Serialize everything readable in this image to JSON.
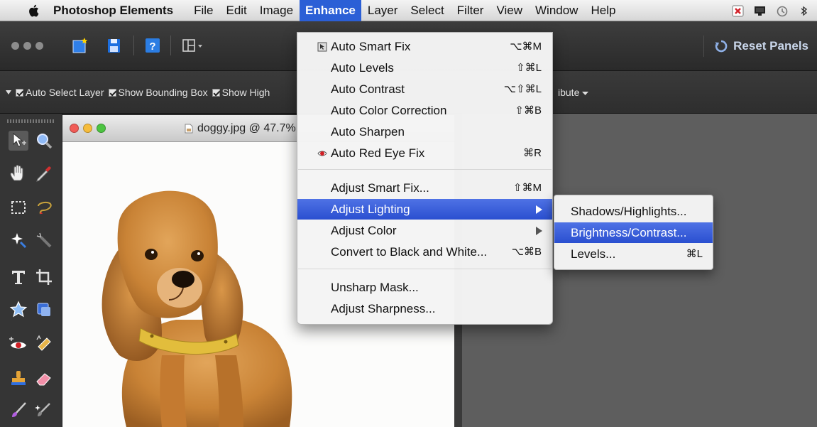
{
  "menubar": {
    "app_name": "Photoshop Elements",
    "menus": [
      "File",
      "Edit",
      "Image",
      "Enhance",
      "Layer",
      "Select",
      "Filter",
      "View",
      "Window",
      "Help"
    ],
    "active_menu": "Enhance"
  },
  "toolbar": {
    "reset_panels": "Reset Panels"
  },
  "options": {
    "auto_select_layer": "Auto Select Layer",
    "show_bounding_box": "Show Bounding Box",
    "show_highlight": "Show High",
    "distribute": "ibute"
  },
  "document": {
    "title": "doggy.jpg @ 47.7%"
  },
  "enhance_menu": {
    "auto_smart_fix": {
      "label": "Auto Smart Fix",
      "shortcut": "⌥⌘M"
    },
    "auto_levels": {
      "label": "Auto Levels",
      "shortcut": "⇧⌘L"
    },
    "auto_contrast": {
      "label": "Auto Contrast",
      "shortcut": "⌥⇧⌘L"
    },
    "auto_color_correction": {
      "label": "Auto Color Correction",
      "shortcut": "⇧⌘B"
    },
    "auto_sharpen": {
      "label": "Auto Sharpen"
    },
    "auto_red_eye_fix": {
      "label": "Auto Red Eye Fix",
      "shortcut": "⌘R"
    },
    "adjust_smart_fix": {
      "label": "Adjust Smart Fix...",
      "shortcut": "⇧⌘M"
    },
    "adjust_lighting": {
      "label": "Adjust Lighting"
    },
    "adjust_color": {
      "label": "Adjust Color"
    },
    "convert_bw": {
      "label": "Convert to Black and White...",
      "shortcut": "⌥⌘B"
    },
    "unsharp_mask": {
      "label": "Unsharp Mask..."
    },
    "adjust_sharpness": {
      "label": "Adjust Sharpness..."
    }
  },
  "lighting_submenu": {
    "shadows_highlights": {
      "label": "Shadows/Highlights..."
    },
    "brightness_contrast": {
      "label": "Brightness/Contrast..."
    },
    "levels": {
      "label": "Levels...",
      "shortcut": "⌘L"
    }
  },
  "colors": {
    "menu_highlight": "#2b5fd6",
    "workspace": "#5e5e5e",
    "panel": "#353535"
  }
}
